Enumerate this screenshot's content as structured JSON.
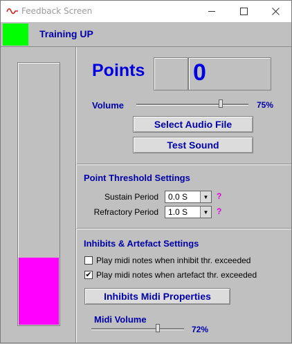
{
  "window": {
    "title": "Feedback Screen"
  },
  "header": {
    "status_color": "#00ff00",
    "training_label": "Training UP"
  },
  "meter": {
    "fill_color": "#ff00ff",
    "level": 0.255
  },
  "points": {
    "label": "Points",
    "value": "0"
  },
  "volume": {
    "label": "Volume",
    "value_text": "75%",
    "value": 75
  },
  "buttons": {
    "select_audio": "Select Audio File",
    "test_sound": "Test Sound",
    "midi_properties": "Inhibits Midi Properties"
  },
  "threshold": {
    "title": "Point Threshold Settings",
    "sustain_label": "Sustain Period",
    "sustain_value": "0.0 S",
    "refractory_label": "Refractory Period",
    "refractory_value": "1.0 S",
    "help": "?"
  },
  "inhibits": {
    "title": "Inhibits & Artefact Settings",
    "inhibit_label": "Play midi notes when inhibit thr. exceeded",
    "inhibit_checked": false,
    "artefact_label": "Play midi notes when artefact thr. exceeded",
    "artefact_checked": true,
    "check_mark": "✔"
  },
  "midi_volume": {
    "label": "Midi Volume",
    "value_text": "72%",
    "value": 72
  }
}
